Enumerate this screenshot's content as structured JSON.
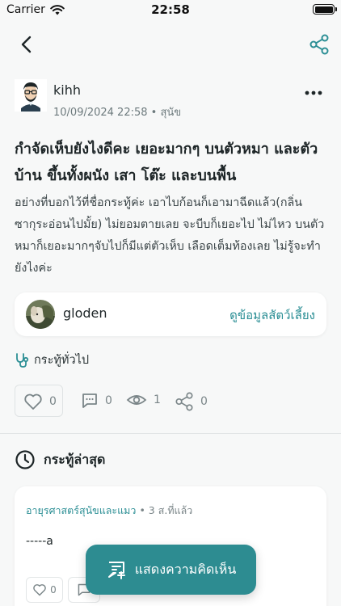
{
  "status_bar": {
    "carrier": "Carrier",
    "time": "22:58"
  },
  "post": {
    "author": "kihh",
    "date": "10/09/2024 22:58 • สุนัข",
    "title": "กำจัดเห็บยังไงดีคะ เยอะมากๆ บนตัวหมา และตัวบ้าน ขึ้นทั้งผนัง เสา โต๊ะ และบนพื้น",
    "body": "อย่างที่บอกไว้ที่ชื่อกระทู้ค่ะ เอาไบก้อนก็เอามาฉีดแล้ว(กลิ่นซากุระอ่อนไปมั้ย) ไม่ยอมตายเลย จะบีบก็เยอะไป ไม่ไหว บนตัวหมาก็เยอะมากๆจับไปก็มีแต่ตัวเห็บ เลือดเต็มท้องเลย ไม่รู้จะทำยังไงค่ะ"
  },
  "pet": {
    "name": "gloden",
    "link_label": "ดูข้อมูลสัตว์เลี้ยง"
  },
  "category": {
    "label": "กระทู้ทั่วไป"
  },
  "stats": {
    "likes": "0",
    "comments": "0",
    "views": "1",
    "shares": "0"
  },
  "recent": {
    "title": "กระทู้ล่าสุด"
  },
  "comment": {
    "category": "อายุรศาสตร์สุนัขและแมว",
    "time": "• 3 ส.ที่แล้ว",
    "text": "-----a",
    "likes": "0"
  },
  "fab": {
    "label": "แสดงความคิดเห็น"
  },
  "colors": {
    "accent": "#2d8c91",
    "link": "#2c8f95",
    "background": "#f7f8f8"
  },
  "icons": [
    "wifi-icon",
    "battery-icon",
    "back-icon",
    "share-icon",
    "more-icon",
    "stethoscope-icon",
    "heart-icon",
    "comment-icon",
    "eye-icon",
    "clock-icon",
    "add-comment-icon"
  ]
}
